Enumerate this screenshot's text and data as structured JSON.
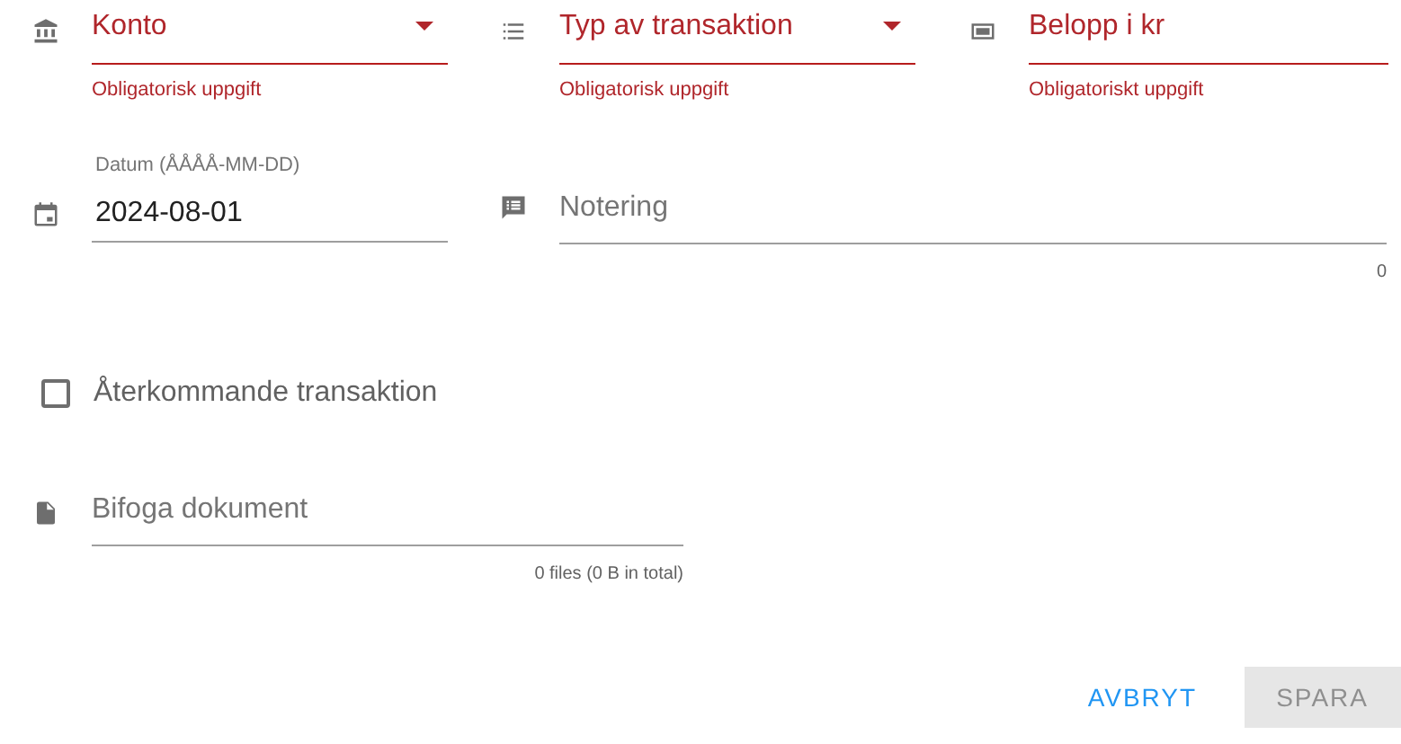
{
  "fields": [
    {
      "kind": "select",
      "placeholder": "Konto",
      "error": true,
      "hint": "Obligatorisk uppgift"
    },
    {
      "kind": "select",
      "placeholder": "Typ av transaktion",
      "error": true,
      "hint": "Obligatorisk uppgift"
    },
    {
      "kind": "text",
      "placeholder": "Belopp i kr",
      "error": true,
      "hint": "Obligatoriskt uppgift"
    }
  ],
  "date": {
    "label": "Datum (ÅÅÅÅ-MM-DD)",
    "value": "2024-08-01"
  },
  "note": {
    "placeholder": "Notering",
    "counter": "0"
  },
  "recurring": {
    "label": "Återkommande transaktion",
    "checked": false
  },
  "attachment": {
    "placeholder": "Bifoga dokument",
    "summary": "0 files (0 B in total)"
  },
  "buttons": [
    {
      "label": "AVBRYT",
      "disabled": false
    },
    {
      "label": "SPARA",
      "disabled": true
    }
  ]
}
